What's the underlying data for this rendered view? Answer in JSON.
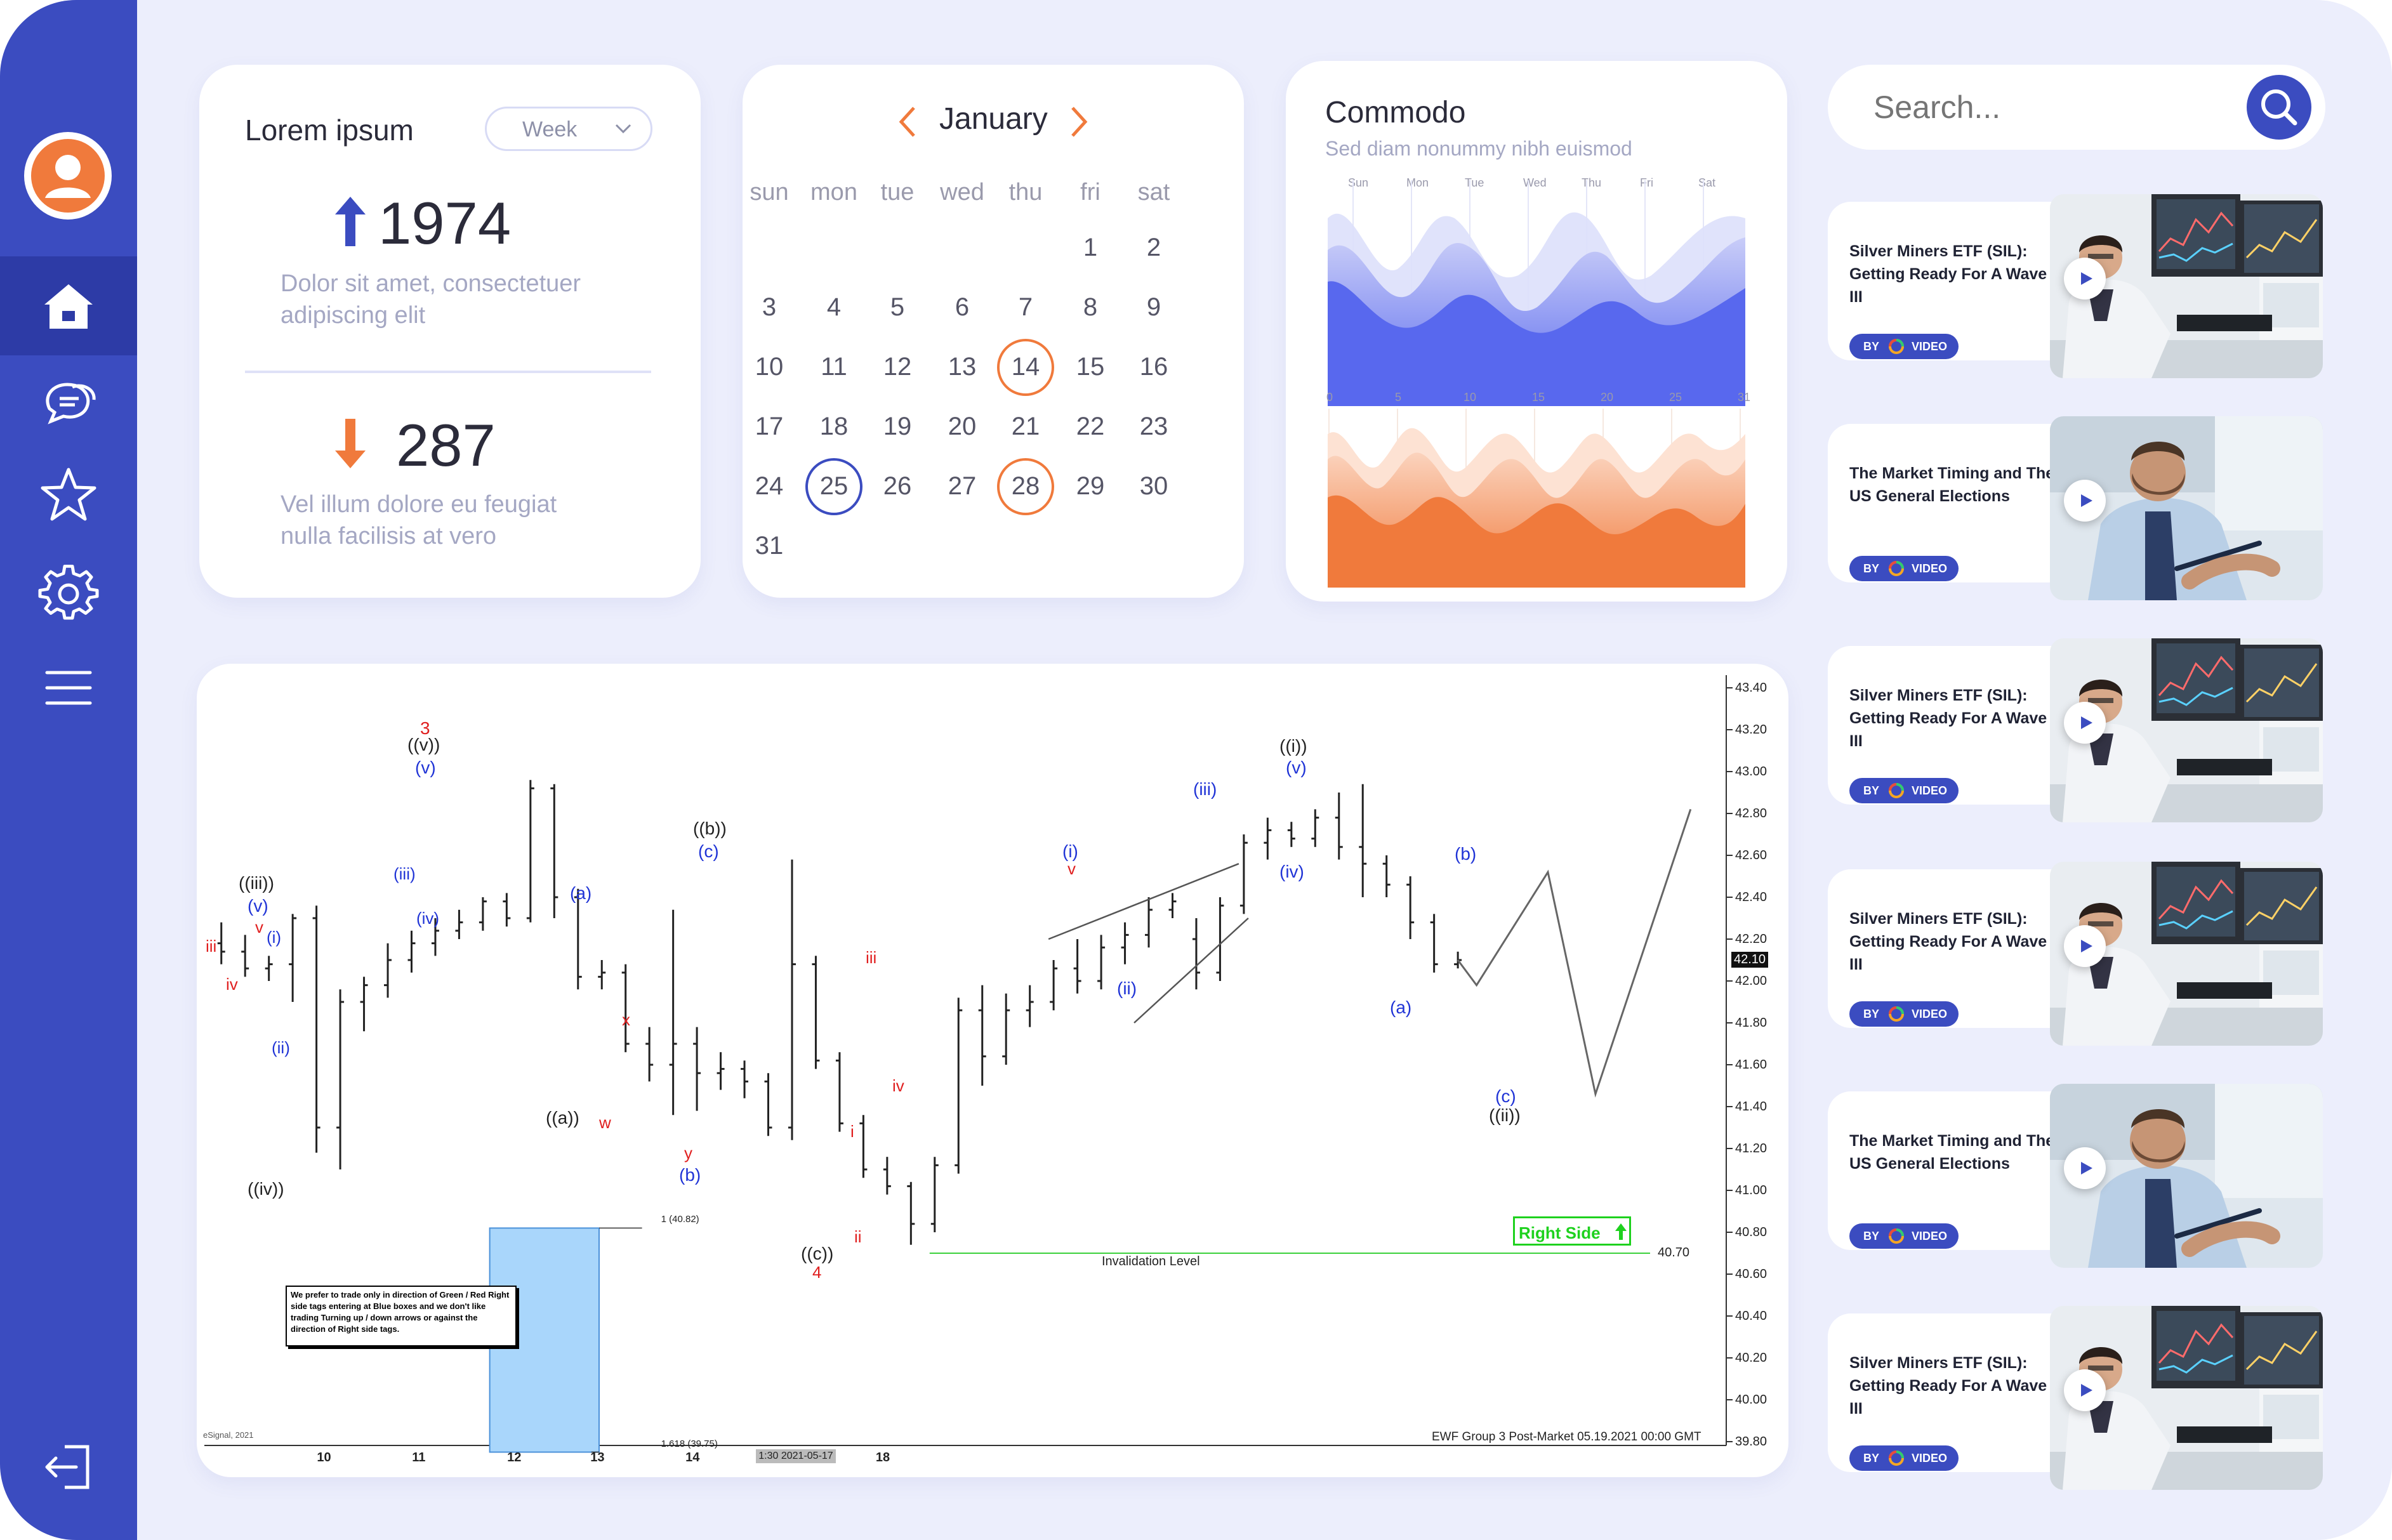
{
  "colors": {
    "sidebar": "#3b4cc0",
    "sidebar_active": "#2d3ba6",
    "background": "#eceefc",
    "accent_blue": "#3b4cc0",
    "accent_orange": "#f07a3c"
  },
  "sidebar": {
    "items": [
      {
        "icon": "user-avatar"
      },
      {
        "icon": "home-icon",
        "active": true
      },
      {
        "icon": "chat-icon"
      },
      {
        "icon": "star-icon"
      },
      {
        "icon": "gear-icon"
      },
      {
        "icon": "menu-icon"
      },
      {
        "icon": "logout-icon"
      }
    ]
  },
  "stats": {
    "title": "Lorem ipsum",
    "period": "Week",
    "up_value": "1974",
    "up_desc_1": "Dolor  sit  amet,  consectetuer",
    "up_desc_2": "adipiscing elit",
    "down_value": "287",
    "down_desc_1": "Vel   illum   dolore   eu   feugiat",
    "down_desc_2": "nulla facilisis at vero"
  },
  "calendar": {
    "month": "January",
    "weekdays": [
      "sun",
      "mon",
      "tue",
      "wed",
      "thu",
      "fri",
      "sat"
    ],
    "days": [
      "1",
      "2",
      "3",
      "4",
      "5",
      "6",
      "7",
      "8",
      "9",
      "10",
      "11",
      "12",
      "13",
      "14",
      "15",
      "16",
      "17",
      "18",
      "19",
      "20",
      "21",
      "22",
      "23",
      "24",
      "25",
      "26",
      "27",
      "28",
      "29",
      "30",
      "31"
    ],
    "highlight_orange": [
      "14",
      "28"
    ],
    "highlight_blue": [
      "25"
    ]
  },
  "commodo": {
    "title": "Commodo",
    "subtitle": "Sed diam nonummy nibh euismod",
    "top_labels": [
      "Sun",
      "Mon",
      "Tue",
      "Wed",
      "Thu",
      "Fri",
      "Sat"
    ],
    "bottom_labels": [
      "0",
      "5",
      "10",
      "15",
      "20",
      "25",
      "31"
    ]
  },
  "search": {
    "placeholder": "Search..."
  },
  "videos": [
    {
      "title": "Silver Miners ETF (SIL): Getting Ready For A Wave III",
      "badge_by": "BY",
      "badge_label": "VIDEO",
      "thumb": "trader-monitors"
    },
    {
      "title": "The Market Timing and The US General Elections",
      "badge_by": "BY",
      "badge_label": "VIDEO",
      "thumb": "businessman-pen"
    },
    {
      "title": "Silver Miners ETF (SIL): Getting Ready For A Wave III",
      "badge_by": "BY",
      "badge_label": "VIDEO",
      "thumb": "trader-monitors"
    },
    {
      "title": "Silver Miners ETF (SIL): Getting Ready For A Wave III",
      "badge_by": "BY",
      "badge_label": "VIDEO",
      "thumb": "trader-monitors"
    },
    {
      "title": "The Market Timing and The US General Elections",
      "badge_by": "BY",
      "badge_label": "VIDEO",
      "thumb": "businessman-pen"
    },
    {
      "title": "Silver Miners ETF (SIL): Getting Ready For A Wave III",
      "badge_by": "BY",
      "badge_label": "VIDEO",
      "thumb": "trader-monitors"
    }
  ],
  "chart_data": {
    "type": "bar",
    "style": "OHLC price bars with Elliott wave annotations",
    "title": "",
    "footer": "EWF Group 3 Post-Market 05.19.2021 00:00 GMT",
    "source_label": "eSignal, 2021",
    "ylim": [
      39.8,
      43.4
    ],
    "y_ticks": [
      "43.40",
      "43.20",
      "43.00",
      "42.80",
      "42.60",
      "42.40",
      "42.20",
      "42.00",
      "41.80",
      "41.60",
      "41.40",
      "41.20",
      "41.00",
      "40.80",
      "40.60",
      "40.40",
      "40.20",
      "40.00",
      "39.80"
    ],
    "last_price_label": "42.10",
    "x_tick_labels": [
      "10",
      "11",
      "12",
      "13",
      "14",
      "18"
    ],
    "x_cursor_label": "1:30 2021-05-17",
    "invalidation": {
      "value": 40.7,
      "label": "Invalidation Level",
      "value_label": "40.70"
    },
    "box_top_label": "1 (40.82)",
    "box_bottom_label": "1.618 (39.75)",
    "right_side_label": "Right Side",
    "note": "We prefer to trade only in direction of Green / Red Right side tags entering at Blue boxes and we don't like trading Turning up / down arrows or against the direction of Right side tags.",
    "labels": {
      "iii": "iii",
      "iv": "iv",
      "v": "v",
      "i": "i",
      "ii": "ii",
      "l_iii_paren": "((iii))",
      "l_v": "(v)",
      "l_i": "(i)",
      "l_ii": "(ii)",
      "l_iv_paren": "((iv))",
      "l_iii": "(iii)",
      "l_iv": "(iv)",
      "w3": "3",
      "l_v_paren": "((v))",
      "l_a": "(a)",
      "l_a_paren": "((a))",
      "w": "w",
      "x": "x",
      "y": "y",
      "l_b": "(b)",
      "l_b_paren": "((b))",
      "l_c": "(c)",
      "l_c_paren": "((c))",
      "w4": "4",
      "i_paren": "((i))",
      "l_ii_paren": "((ii))"
    },
    "bars": [
      {
        "x": 1,
        "o": 42.18,
        "h": 42.28,
        "l": 42.08,
        "c": 42.14
      },
      {
        "x": 2,
        "o": 42.14,
        "h": 42.22,
        "l": 42.02,
        "c": 42.06
      },
      {
        "x": 3,
        "o": 42.06,
        "h": 42.12,
        "l": 42.0,
        "c": 42.08
      },
      {
        "x": 4,
        "o": 42.08,
        "h": 42.32,
        "l": 41.9,
        "c": 42.3
      },
      {
        "x": 5,
        "o": 42.3,
        "h": 42.36,
        "l": 41.18,
        "c": 41.3
      },
      {
        "x": 6,
        "o": 41.3,
        "h": 41.96,
        "l": 41.1,
        "c": 41.9
      },
      {
        "x": 7,
        "o": 41.9,
        "h": 42.02,
        "l": 41.76,
        "c": 41.98
      },
      {
        "x": 8,
        "o": 41.98,
        "h": 42.18,
        "l": 41.92,
        "c": 42.1
      },
      {
        "x": 9,
        "o": 42.1,
        "h": 42.24,
        "l": 42.04,
        "c": 42.18
      },
      {
        "x": 10,
        "o": 42.18,
        "h": 42.3,
        "l": 42.12,
        "c": 42.24
      },
      {
        "x": 11,
        "o": 42.24,
        "h": 42.34,
        "l": 42.2,
        "c": 42.28
      },
      {
        "x": 12,
        "o": 42.28,
        "h": 42.4,
        "l": 42.24,
        "c": 42.38
      },
      {
        "x": 13,
        "o": 42.38,
        "h": 42.42,
        "l": 42.26,
        "c": 42.3
      },
      {
        "x": 14,
        "o": 42.3,
        "h": 42.96,
        "l": 42.28,
        "c": 42.92
      },
      {
        "x": 15,
        "o": 42.92,
        "h": 42.94,
        "l": 42.3,
        "c": 42.4
      },
      {
        "x": 16,
        "o": 42.4,
        "h": 42.44,
        "l": 41.96,
        "c": 42.02
      },
      {
        "x": 17,
        "o": 42.02,
        "h": 42.1,
        "l": 41.96,
        "c": 42.04
      },
      {
        "x": 18,
        "o": 42.04,
        "h": 42.08,
        "l": 41.66,
        "c": 41.7
      },
      {
        "x": 19,
        "o": 41.7,
        "h": 41.78,
        "l": 41.52,
        "c": 41.6
      },
      {
        "x": 20,
        "o": 41.6,
        "h": 42.34,
        "l": 41.36,
        "c": 41.7
      },
      {
        "x": 21,
        "o": 41.7,
        "h": 41.78,
        "l": 41.38,
        "c": 41.56
      },
      {
        "x": 22,
        "o": 41.56,
        "h": 41.66,
        "l": 41.48,
        "c": 41.58
      },
      {
        "x": 23,
        "o": 41.58,
        "h": 41.62,
        "l": 41.44,
        "c": 41.52
      },
      {
        "x": 24,
        "o": 41.52,
        "h": 41.56,
        "l": 41.26,
        "c": 41.3
      },
      {
        "x": 25,
        "o": 41.3,
        "h": 42.58,
        "l": 41.24,
        "c": 42.08
      },
      {
        "x": 26,
        "o": 42.08,
        "h": 42.12,
        "l": 41.58,
        "c": 41.62
      },
      {
        "x": 27,
        "o": 41.62,
        "h": 41.66,
        "l": 41.28,
        "c": 41.32
      },
      {
        "x": 28,
        "o": 41.32,
        "h": 41.36,
        "l": 41.06,
        "c": 41.1
      },
      {
        "x": 29,
        "o": 41.1,
        "h": 41.16,
        "l": 40.98,
        "c": 41.02
      },
      {
        "x": 30,
        "o": 41.02,
        "h": 41.04,
        "l": 40.74,
        "c": 40.84
      },
      {
        "x": 31,
        "o": 40.84,
        "h": 41.16,
        "l": 40.8,
        "c": 41.12
      },
      {
        "x": 32,
        "o": 41.12,
        "h": 41.92,
        "l": 41.08,
        "c": 41.86
      },
      {
        "x": 33,
        "o": 41.86,
        "h": 41.98,
        "l": 41.5,
        "c": 41.64
      },
      {
        "x": 34,
        "o": 41.64,
        "h": 41.94,
        "l": 41.6,
        "c": 41.86
      },
      {
        "x": 35,
        "o": 41.86,
        "h": 41.98,
        "l": 41.78,
        "c": 41.9
      },
      {
        "x": 36,
        "o": 41.9,
        "h": 42.1,
        "l": 41.86,
        "c": 42.06
      },
      {
        "x": 37,
        "o": 42.06,
        "h": 42.2,
        "l": 41.94,
        "c": 42.0
      },
      {
        "x": 38,
        "o": 42.0,
        "h": 42.22,
        "l": 41.96,
        "c": 42.16
      },
      {
        "x": 39,
        "o": 42.16,
        "h": 42.28,
        "l": 42.08,
        "c": 42.22
      },
      {
        "x": 40,
        "o": 42.22,
        "h": 42.4,
        "l": 42.16,
        "c": 42.34
      },
      {
        "x": 41,
        "o": 42.34,
        "h": 42.42,
        "l": 42.3,
        "c": 42.38
      },
      {
        "x": 42,
        "o": 42.2,
        "h": 42.3,
        "l": 41.96,
        "c": 42.04
      },
      {
        "x": 43,
        "o": 42.04,
        "h": 42.4,
        "l": 42.0,
        "c": 42.36
      },
      {
        "x": 44,
        "o": 42.36,
        "h": 42.7,
        "l": 42.32,
        "c": 42.66
      },
      {
        "x": 45,
        "o": 42.66,
        "h": 42.78,
        "l": 42.58,
        "c": 42.72
      },
      {
        "x": 46,
        "o": 42.72,
        "h": 42.76,
        "l": 42.64,
        "c": 42.68
      },
      {
        "x": 47,
        "o": 42.68,
        "h": 42.82,
        "l": 42.64,
        "c": 42.78
      },
      {
        "x": 48,
        "o": 42.78,
        "h": 42.9,
        "l": 42.58,
        "c": 42.64
      },
      {
        "x": 49,
        "o": 42.64,
        "h": 42.94,
        "l": 42.4,
        "c": 42.56
      },
      {
        "x": 50,
        "o": 42.56,
        "h": 42.6,
        "l": 42.4,
        "c": 42.46
      },
      {
        "x": 51,
        "o": 42.46,
        "h": 42.5,
        "l": 42.2,
        "c": 42.28
      },
      {
        "x": 52,
        "o": 42.28,
        "h": 42.32,
        "l": 42.04,
        "c": 42.08
      },
      {
        "x": 53,
        "o": 42.08,
        "h": 42.14,
        "l": 42.06,
        "c": 42.1
      }
    ],
    "projection": [
      {
        "x": 54,
        "y": 41.98
      },
      {
        "x": 57,
        "y": 42.52
      },
      {
        "x": 59,
        "y": 41.46
      },
      {
        "x": 63,
        "y": 42.82
      }
    ]
  }
}
